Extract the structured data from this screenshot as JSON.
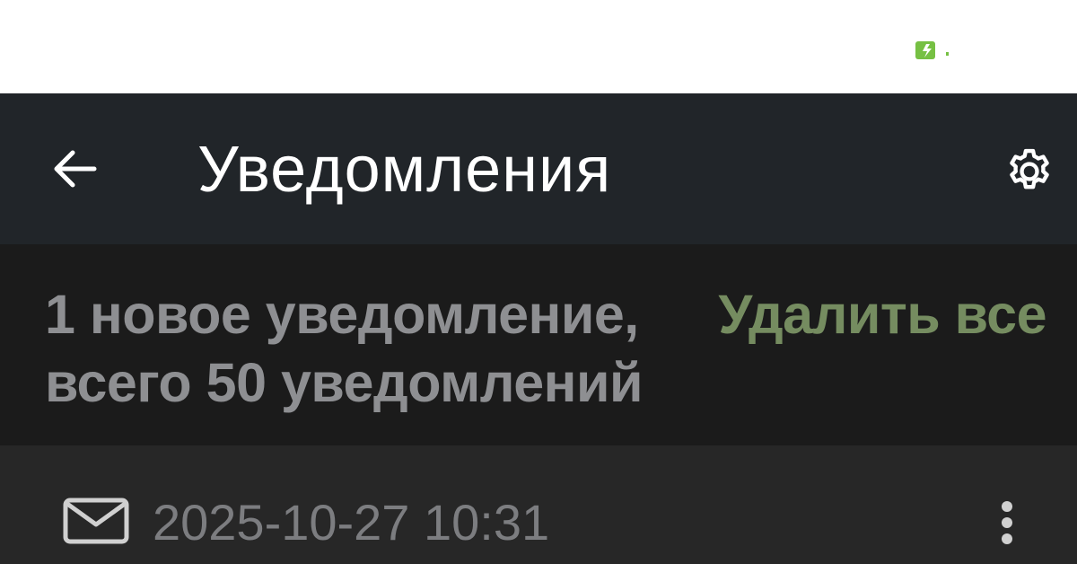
{
  "colors": {
    "toolbar_bg": "#212529",
    "summary_bg": "#1b1b1b",
    "item_bg": "#272727",
    "accent": "#758c60",
    "battery": "#76c043"
  },
  "icons": {
    "back": "arrow-left-icon",
    "settings": "gear-icon",
    "notification": "envelope-icon",
    "more": "more-vertical-icon",
    "battery": "battery-charging-icon"
  },
  "toolbar": {
    "title": "Уведомления"
  },
  "summary": {
    "line1": "1 новое уведомление,",
    "line2": "всего 50 уведомлений",
    "delete_all_label": "Удалить все"
  },
  "notifications": [
    {
      "timestamp": "2025-10-27 10:31"
    }
  ]
}
